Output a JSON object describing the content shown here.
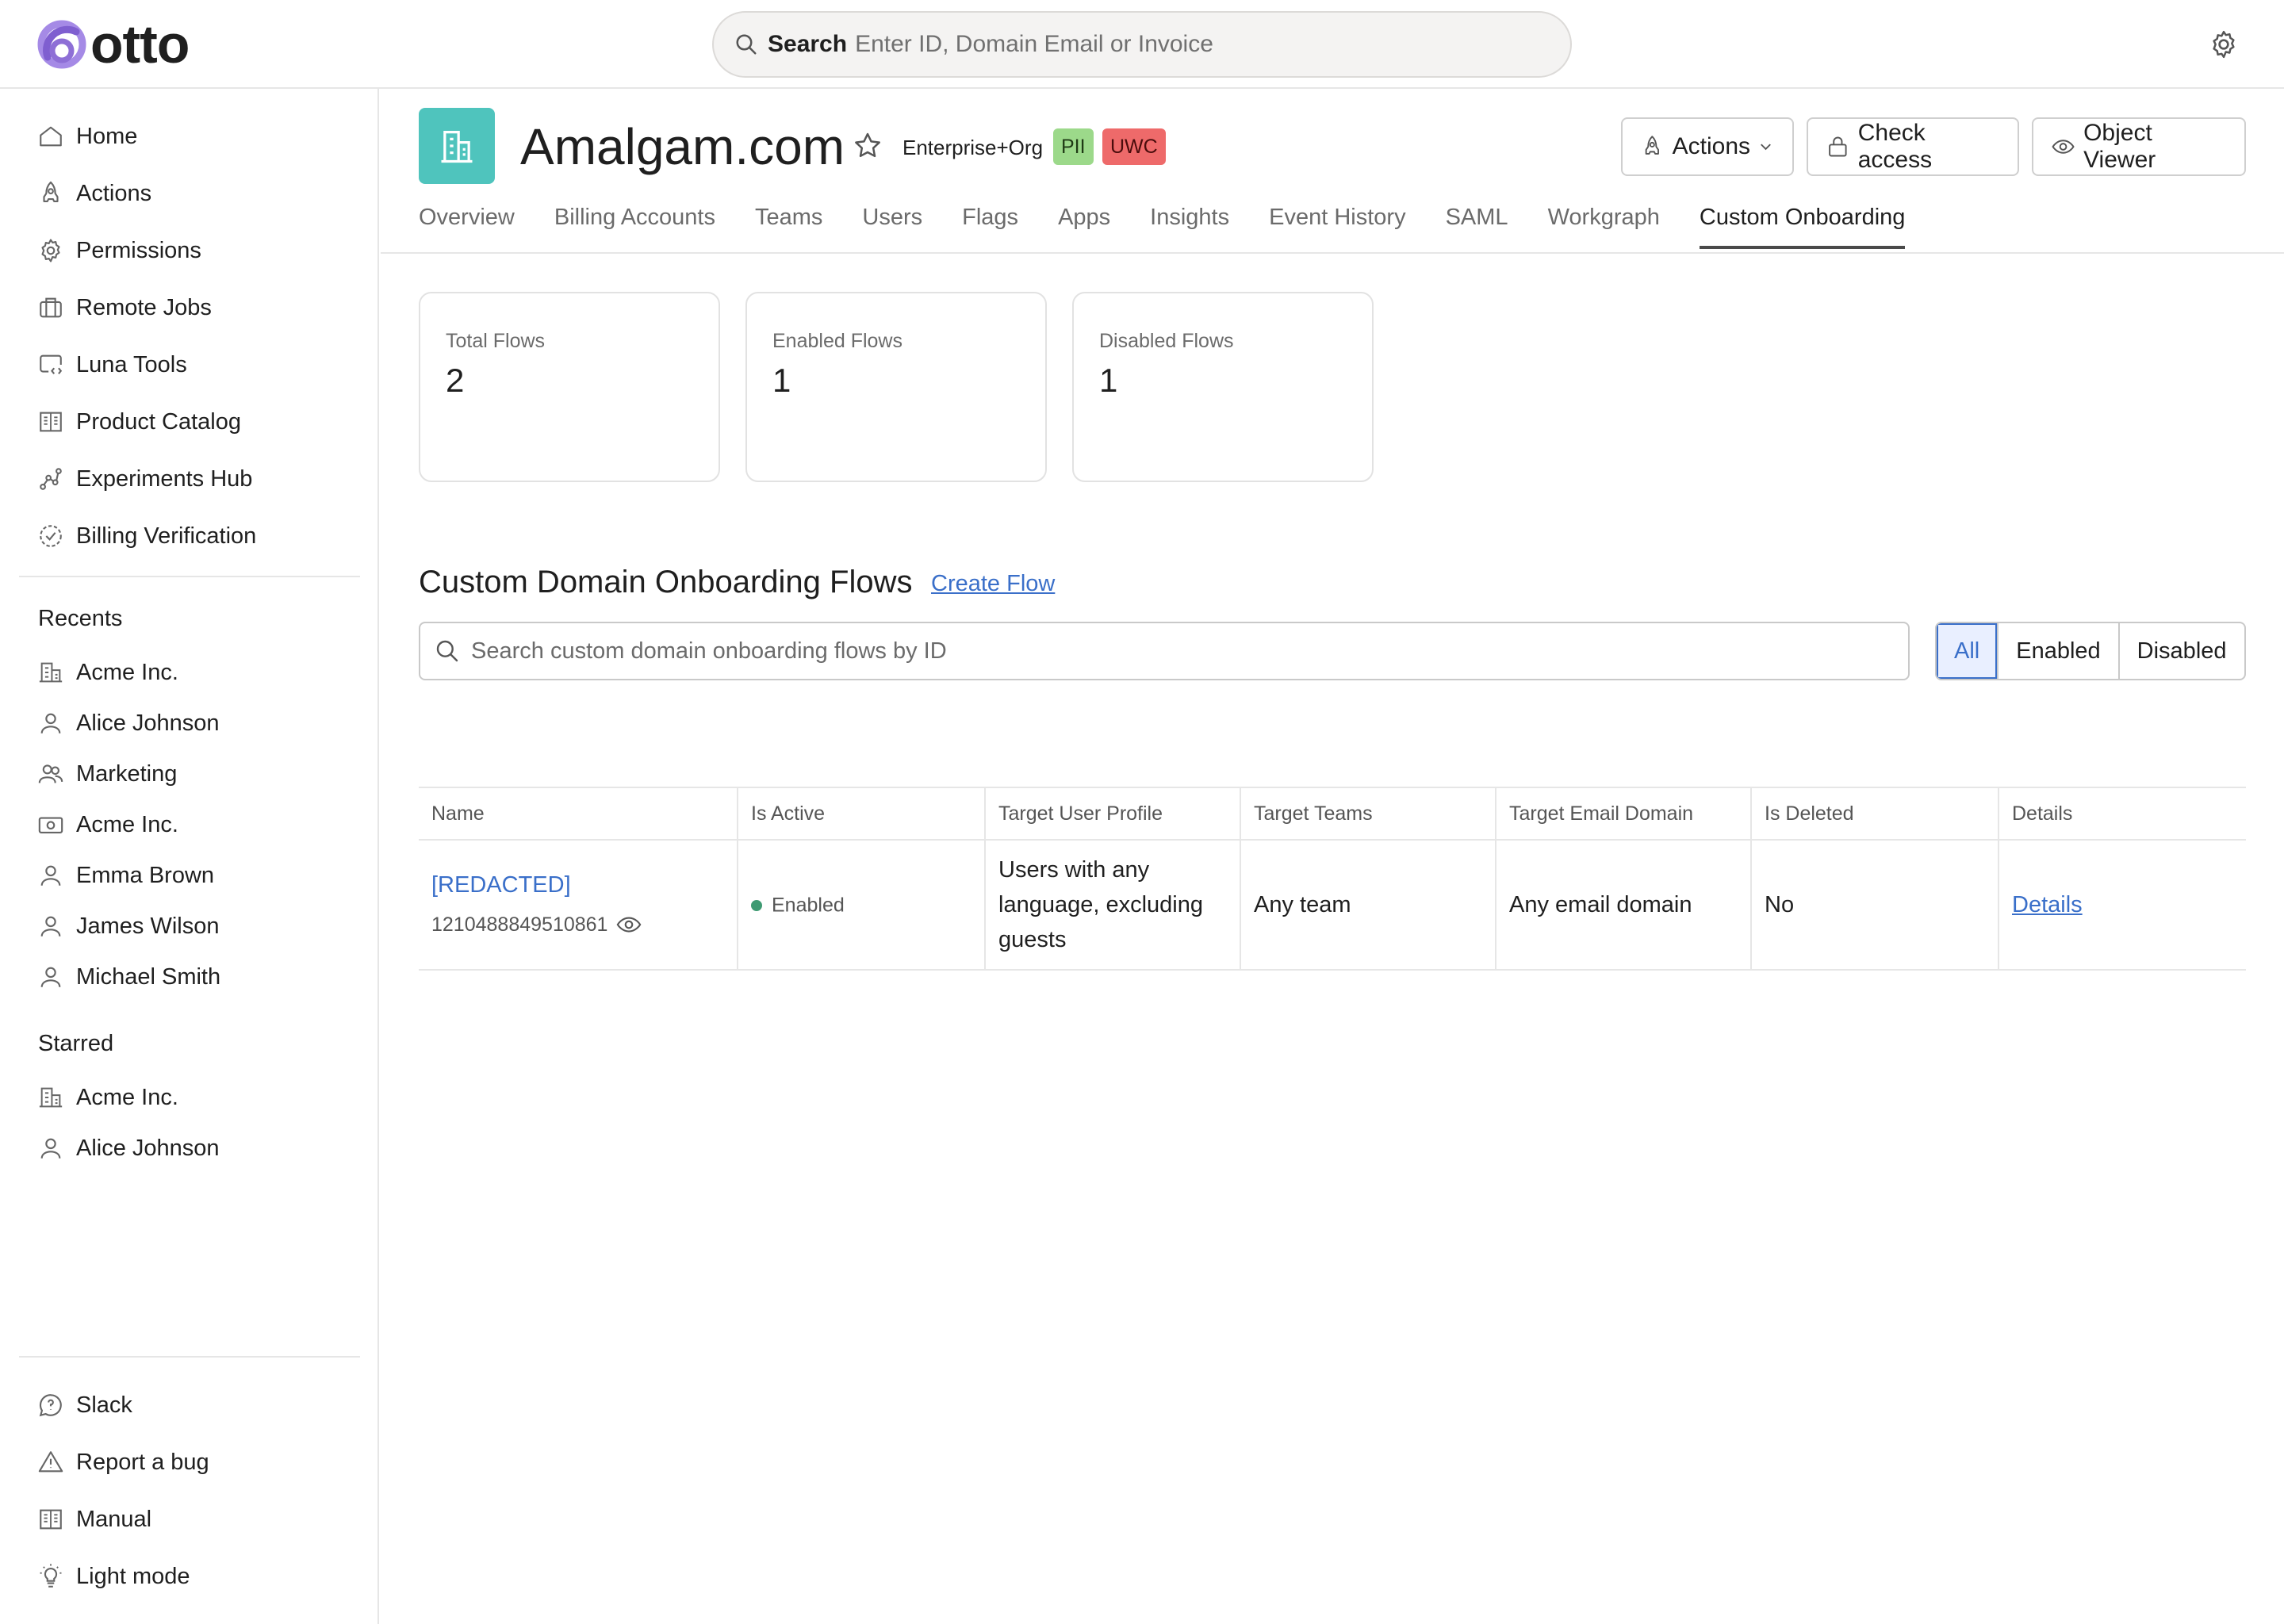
{
  "app": {
    "logo_text": "otto"
  },
  "top_search": {
    "label": "Search",
    "placeholder": "Enter ID, Domain Email or Invoice"
  },
  "sidebar": {
    "nav": [
      {
        "label": "Home",
        "icon": "home-icon"
      },
      {
        "label": "Actions",
        "icon": "rocket-icon"
      },
      {
        "label": "Permissions",
        "icon": "gear-icon"
      },
      {
        "label": "Remote Jobs",
        "icon": "briefcase-icon"
      },
      {
        "label": "Luna Tools",
        "icon": "code-window-icon"
      },
      {
        "label": "Product Catalog",
        "icon": "book-icon"
      },
      {
        "label": "Experiments Hub",
        "icon": "graph-icon"
      },
      {
        "label": "Billing Verification",
        "icon": "check-badge-icon"
      }
    ],
    "recents_heading": "Recents",
    "recents": [
      {
        "label": "Acme Inc.",
        "icon": "building-icon"
      },
      {
        "label": "Alice Johnson",
        "icon": "user-icon"
      },
      {
        "label": "Marketing",
        "icon": "team-icon"
      },
      {
        "label": "Acme Inc.",
        "icon": "billing-icon"
      },
      {
        "label": "Emma Brown",
        "icon": "user-icon"
      },
      {
        "label": "James Wilson",
        "icon": "user-icon"
      },
      {
        "label": "Michael Smith",
        "icon": "user-icon"
      }
    ],
    "starred_heading": "Starred",
    "starred": [
      {
        "label": "Acme Inc.",
        "icon": "building-icon"
      },
      {
        "label": "Alice Johnson",
        "icon": "user-icon"
      }
    ],
    "footer": [
      {
        "label": "Slack",
        "icon": "chat-icon"
      },
      {
        "label": "Report a bug",
        "icon": "warning-icon"
      },
      {
        "label": "Manual",
        "icon": "book-icon"
      },
      {
        "label": "Light mode",
        "icon": "lightbulb-icon"
      }
    ]
  },
  "header": {
    "title": "Amalgam.com",
    "plan": "Enterprise+Org",
    "badges": {
      "pii": "PII",
      "uwc": "UWC"
    },
    "buttons": {
      "actions": "Actions",
      "check_access": "Check access",
      "object_viewer": "Object Viewer"
    },
    "org_icon_color": "#4fc4bd"
  },
  "tabs": [
    "Overview",
    "Billing Accounts",
    "Teams",
    "Users",
    "Flags",
    "Apps",
    "Insights",
    "Event History",
    "SAML",
    "Workgraph",
    "Custom Onboarding"
  ],
  "active_tab": "Custom Onboarding",
  "stats": [
    {
      "label": "Total Flows",
      "value": "2"
    },
    {
      "label": "Enabled Flows",
      "value": "1"
    },
    {
      "label": "Disabled Flows",
      "value": "1"
    }
  ],
  "flows": {
    "title": "Custom Domain Onboarding Flows",
    "create_link": "Create Flow",
    "search_placeholder": "Search custom domain onboarding flows by ID",
    "filter": {
      "options": [
        "All",
        "Enabled",
        "Disabled"
      ],
      "selected": "All"
    },
    "columns": [
      "Name",
      "Is Active",
      "Target User Profile",
      "Target Teams",
      "Target Email Domain",
      "Is Deleted",
      "Details"
    ],
    "rows": [
      {
        "name": "[REDACTED]",
        "id": "1210488849510861",
        "is_active": "Enabled",
        "target_user_profile": "Users with any language, excluding guests",
        "target_teams": "Any team",
        "target_email_domain": "Any email domain",
        "is_deleted": "No",
        "details": "Details"
      }
    ]
  },
  "colors": {
    "accent": "#3a6fc9",
    "status_enabled": "#3e9a72",
    "logo": "#8e6fd6"
  }
}
